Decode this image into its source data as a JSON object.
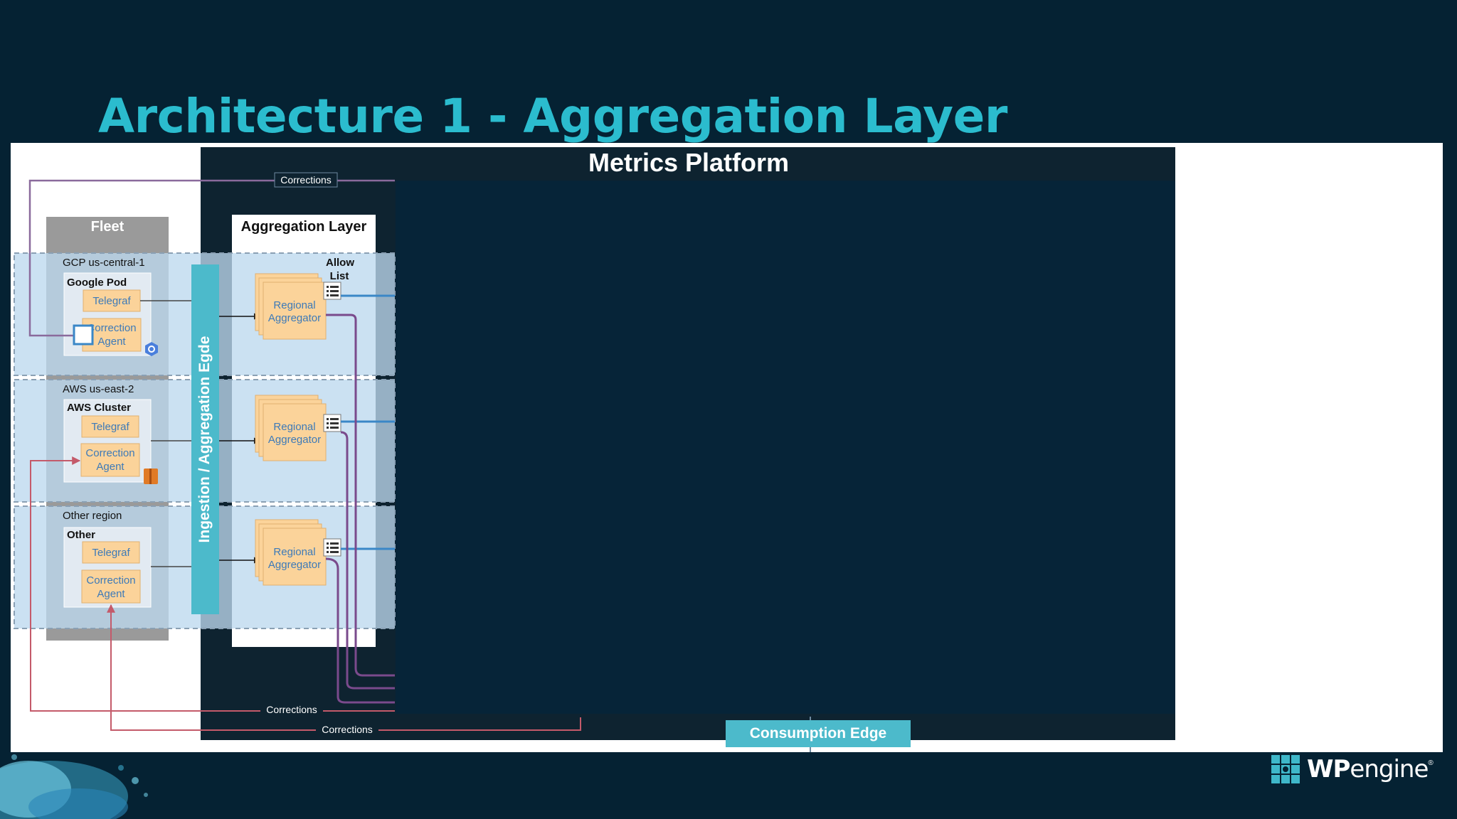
{
  "slide": {
    "title": "Architecture 1 - Aggregation Layer"
  },
  "diagram": {
    "platform_title": "Metrics Platform",
    "fleet_title": "Fleet",
    "aggregation_title": "Aggregation Layer",
    "ingestion_label": "Ingestion / Aggregation Egde",
    "allow_list_line1": "Allow",
    "allow_list_line2": "List",
    "consumption_label": "Consumption Edge",
    "corrections_label": "Corrections",
    "regions": [
      {
        "region_label": "GCP us-central-1",
        "group_label": "Google Pod",
        "telegraf": "Telegraf",
        "agent_line1": "Correction",
        "agent_line2": "Agent",
        "aggregator_line1": "Regional",
        "aggregator_line2": "Aggregator"
      },
      {
        "region_label": "AWS us-east-2",
        "group_label": "AWS Cluster",
        "telegraf": "Telegraf",
        "agent_line1": "Correction",
        "agent_line2": "Agent",
        "aggregator_line1": "Regional",
        "aggregator_line2": "Aggregator"
      },
      {
        "region_label": "Other region",
        "group_label": "Other",
        "telegraf": "Telegraf",
        "agent_line1": "Correction",
        "agent_line2": "Agent",
        "aggregator_line1": "Regional",
        "aggregator_line2": "Aggregator"
      }
    ]
  },
  "brand": {
    "wp": "WP",
    "engine": "engine",
    "registered": "®"
  },
  "colors": {
    "background": "#052233",
    "title": "#2bbcce",
    "platform_panel": "#0e2330",
    "region_band": "#bcd9ee",
    "component_fill": "#fbd39a",
    "component_text": "#3d7ab8",
    "ingestion_edge": "#4cbacb",
    "corrections_line": "#c45a6a",
    "aggregator_output": "#3a87c7",
    "aggregator_to_platform": "#7a4a8c"
  }
}
